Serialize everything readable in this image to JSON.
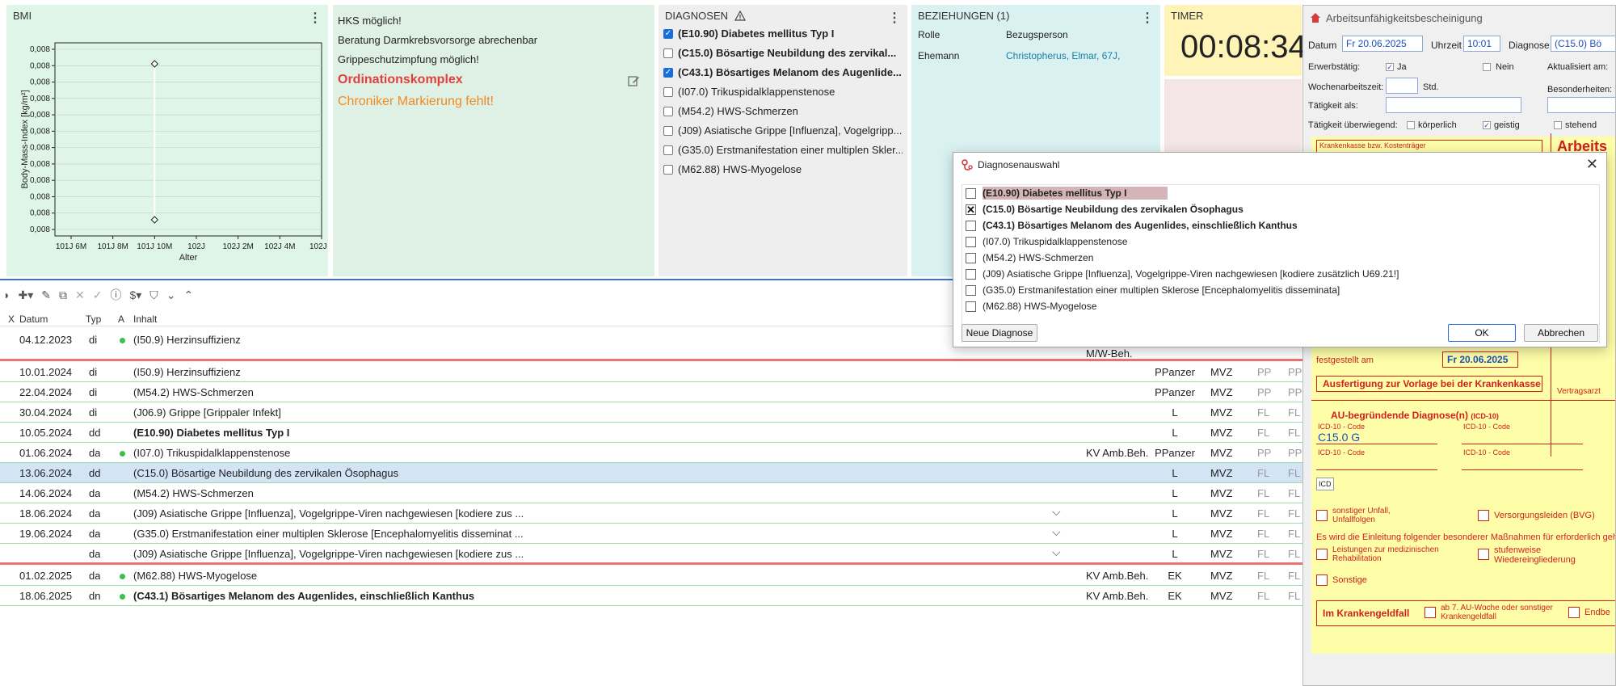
{
  "bmi": {
    "title": "BMI",
    "y_axis_label": "Body-Mass-Index [kg/m²]",
    "y_ticks": [
      "0,008",
      "0,008",
      "0,008",
      "0,008",
      "0,008",
      "0,008",
      "0,008",
      "0,008",
      "0,008",
      "0,008",
      "0,008",
      "0,008"
    ],
    "x_ticks": [
      "101J 6M",
      "101J 8M",
      "101J 10M",
      "102J",
      "102J 2M",
      "102J 4M",
      "102J 6"
    ],
    "x_axis_label": "Alter"
  },
  "chart_data": {
    "type": "scatter",
    "title": "BMI",
    "xlabel": "Alter",
    "ylabel": "Body-Mass-Index [kg/m²]",
    "categories": [
      "101J 6M",
      "101J 8M",
      "101J 10M",
      "102J",
      "102J 2M",
      "102J 4M",
      "102J 6"
    ],
    "series": [
      {
        "x": [
          "101J 10M",
          "101J 10M"
        ],
        "values": [
          0.008,
          0.008
        ]
      }
    ]
  },
  "hints": {
    "lines": [
      "HKS möglich!",
      "Beratung Darmkrebsvorsorge abrechenbar",
      "Grippeschutzimpfung möglich!"
    ],
    "ordination": "Ordinationskomplex",
    "chroniker": "Chroniker Markierung fehlt!"
  },
  "diagnosen": {
    "title": "DIAGNOSEN",
    "items": [
      {
        "label": "(E10.90) Diabetes mellitus Typ I",
        "checked": true,
        "bold": true
      },
      {
        "label": "(C15.0) Bösartige Neubildung des zervikal...",
        "checked": false,
        "bold": true
      },
      {
        "label": "(C43.1) Bösartiges Melanom des Augenlide...",
        "checked": true,
        "bold": true
      },
      {
        "label": "(I07.0) Trikuspidalklappenstenose",
        "checked": false,
        "bold": false
      },
      {
        "label": "(M54.2) HWS-Schmerzen",
        "checked": false,
        "bold": false
      },
      {
        "label": "(J09) Asiatische Grippe [Influenza], Vogelgripp...",
        "checked": false,
        "bold": false
      },
      {
        "label": "(G35.0) Erstmanifestation einer multiplen Skler...",
        "checked": false,
        "bold": false
      },
      {
        "label": "(M62.88) HWS-Myogelose",
        "checked": false,
        "bold": false
      }
    ]
  },
  "beziehungen": {
    "title": "BEZIEHUNGEN (1)",
    "col_rolle": "Rolle",
    "col_bezug": "Bezugsperson",
    "rolle": "Ehemann",
    "person": "Christopherus, Elmar, 67J,"
  },
  "timer": {
    "title": "TIMER",
    "value": "00:08:34"
  },
  "journal": {
    "headers": {
      "x": "X",
      "datum": "Datum",
      "typ": "Typ",
      "a": "A",
      "inhalt": "Inhalt"
    },
    "rows": [
      {
        "datum": "04.12.2023",
        "typ": "di",
        "dot": true,
        "inhalt": "(I50.9) Herzinsuffizienz",
        "bold": false,
        "extra": "",
        "user": "",
        "org": "",
        "k1": "",
        "k2": "",
        "chev": false,
        "sel": false,
        "note": "M/W-Beh."
      },
      {
        "datum": "10.01.2024",
        "typ": "di",
        "dot": false,
        "inhalt": "(I50.9) Herzinsuffizienz",
        "bold": false,
        "extra": "",
        "user": "PPanzer",
        "org": "MVZ",
        "k1": "PP",
        "k2": "PP",
        "chev": false,
        "sel": false
      },
      {
        "datum": "22.04.2024",
        "typ": "di",
        "dot": false,
        "inhalt": "(M54.2) HWS-Schmerzen",
        "bold": false,
        "extra": "",
        "user": "PPanzer",
        "org": "MVZ",
        "k1": "PP",
        "k2": "PP",
        "chev": false,
        "sel": false
      },
      {
        "datum": "30.04.2024",
        "typ": "di",
        "dot": false,
        "inhalt": "(J06.9) Grippe [Grippaler Infekt]",
        "bold": false,
        "extra": "",
        "user": "L",
        "org": "MVZ",
        "k1": "FL",
        "k2": "FL",
        "chev": false,
        "sel": false
      },
      {
        "datum": "10.05.2024",
        "typ": "dd",
        "dot": false,
        "inhalt": "(E10.90) Diabetes mellitus Typ I",
        "bold": true,
        "extra": "",
        "user": "L",
        "org": "MVZ",
        "k1": "FL",
        "k2": "FL",
        "chev": false,
        "sel": false
      },
      {
        "datum": "01.06.2024",
        "typ": "da",
        "dot": true,
        "inhalt": "(I07.0) Trikuspidalklappenstenose",
        "bold": false,
        "extra": "KV Amb.Beh.",
        "user": "PPanzer",
        "org": "MVZ",
        "k1": "PP",
        "k2": "PP",
        "chev": false,
        "sel": false
      },
      {
        "datum": "13.06.2024",
        "typ": "dd",
        "dot": false,
        "inhalt": "(C15.0) Bösartige Neubildung des zervikalen Ösophagus",
        "bold": false,
        "extra": "",
        "user": "L",
        "org": "MVZ",
        "k1": "FL",
        "k2": "FL",
        "chev": false,
        "sel": true
      },
      {
        "datum": "14.06.2024",
        "typ": "da",
        "dot": false,
        "inhalt": "(M54.2) HWS-Schmerzen",
        "bold": false,
        "extra": "",
        "user": "L",
        "org": "MVZ",
        "k1": "FL",
        "k2": "FL",
        "chev": false,
        "sel": false
      },
      {
        "datum": "18.06.2024",
        "typ": "da",
        "dot": false,
        "inhalt": "(J09) Asiatische Grippe [Influenza], Vogelgrippe-Viren nachgewiesen [kodiere zus ...",
        "bold": false,
        "extra": "",
        "user": "L",
        "org": "MVZ",
        "k1": "FL",
        "k2": "FL",
        "chev": true,
        "sel": false
      },
      {
        "datum": "19.06.2024",
        "typ": "da",
        "dot": false,
        "inhalt": "(G35.0) Erstmanifestation einer multiplen Sklerose [Encephalomyelitis disseminat ...",
        "bold": false,
        "extra": "",
        "user": "L",
        "org": "MVZ",
        "k1": "FL",
        "k2": "FL",
        "chev": true,
        "sel": false
      },
      {
        "datum": "",
        "typ": "da",
        "dot": false,
        "inhalt": "(J09) Asiatische Grippe [Influenza], Vogelgrippe-Viren nachgewiesen [kodiere zus ...",
        "bold": false,
        "extra": "",
        "user": "L",
        "org": "MVZ",
        "k1": "FL",
        "k2": "FL",
        "chev": true,
        "sel": false
      },
      {
        "datum": "01.02.2025",
        "typ": "da",
        "dot": true,
        "inhalt": "(M62.88) HWS-Myogelose",
        "bold": false,
        "extra": "KV Amb.Beh.",
        "user": "EK",
        "org": "MVZ",
        "k1": "FL",
        "k2": "FL",
        "chev": false,
        "sel": false
      },
      {
        "datum": "18.06.2025",
        "typ": "dn",
        "dot": true,
        "inhalt": "(C43.1) Bösartiges Melanom des Augenlides, einschließlich Kanthus",
        "bold": true,
        "extra": "KV Amb.Beh.",
        "user": "EK",
        "org": "MVZ",
        "k1": "FL",
        "k2": "FL",
        "chev": false,
        "sel": false
      }
    ]
  },
  "au": {
    "title": "Arbeitsunfähigkeitsbescheinigung",
    "datum_label": "Datum",
    "datum_value": "Fr 20.06.2025",
    "uhrzeit_label": "Uhrzeit",
    "uhrzeit_value": "10:01",
    "diagnose_label": "Diagnose",
    "diagnose_value": "(C15.0) Bö",
    "erwerbstaetig": "Erwerbstätig:",
    "ja": "Ja",
    "nein": "Nein",
    "aktualisiert": "Aktualisiert am:",
    "wochen": "Wochenarbeitszeit:",
    "std": "Std.",
    "besonderheiten": "Besonderheiten:",
    "taetigkeit_als": "Tätigkeit als:",
    "taetigkeit_ueber": "Tätigkeit überwiegend:",
    "koerperlich": "körperlich",
    "geistig": "geistig",
    "stehend": "stehend",
    "krankenkasse": "Krankenkasse bzw. Kostenträger",
    "arbeit_big": "Arbeits",
    "festgestellt": "festgestellt am",
    "festgestellt_date": "Fr 20.06.2025",
    "ausfertigung": "Ausfertigung zur Vorlage bei der Krankenkasse",
    "vertragsarzt": "Vertragsarzt",
    "au_diag": "AU-begründende Diagnose(n)",
    "icd10": "(ICD-10)",
    "icd_code": "ICD-10 - Code",
    "icd_value": "C15.0 G",
    "icd": "ICD",
    "unfall": "sonstiger Unfall, Unfallfolgen",
    "versorgung": "Versorgungsleiden (BVG)",
    "einleitung": "Es wird die Einleitung folgender besonderer Maßnahmen für erforderlich gehalten",
    "reha": "Leistungen zur medizinischen Rehabilitation",
    "stufen": "stufenweise Wiedereingliederung",
    "sonstige": "Sonstige",
    "krankengeld": "Im Krankengeldfall",
    "woche7": "ab 7. AU-Woche oder sonstiger Krankengeldfall",
    "endbe": "Endbe"
  },
  "dialog": {
    "title": "Diagnosenauswahl",
    "items": [
      {
        "label": "(E10.90) Diabetes mellitus Typ I",
        "checked": false,
        "bold": true,
        "highlight": true
      },
      {
        "label": "(C15.0) Bösartige Neubildung des zervikalen Ösophagus",
        "checked": true,
        "bold": true,
        "highlight": false
      },
      {
        "label": "(C43.1) Bösartiges Melanom des Augenlides, einschließlich Kanthus",
        "checked": false,
        "bold": true,
        "highlight": false
      },
      {
        "label": "(I07.0) Trikuspidalklappenstenose",
        "checked": false,
        "bold": false,
        "highlight": false
      },
      {
        "label": "(M54.2) HWS-Schmerzen",
        "checked": false,
        "bold": false,
        "highlight": false
      },
      {
        "label": "(J09) Asiatische Grippe [Influenza], Vogelgrippe-Viren nachgewiesen [kodiere zusätzlich U69.21!]",
        "checked": false,
        "bold": false,
        "highlight": false
      },
      {
        "label": "(G35.0) Erstmanifestation einer multiplen Sklerose [Encephalomyelitis disseminata]",
        "checked": false,
        "bold": false,
        "highlight": false
      },
      {
        "label": "(M62.88) HWS-Myogelose",
        "checked": false,
        "bold": false,
        "highlight": false
      }
    ],
    "neue": "Neue Diagnose",
    "ok": "OK",
    "abbrechen": "Abbrechen"
  }
}
